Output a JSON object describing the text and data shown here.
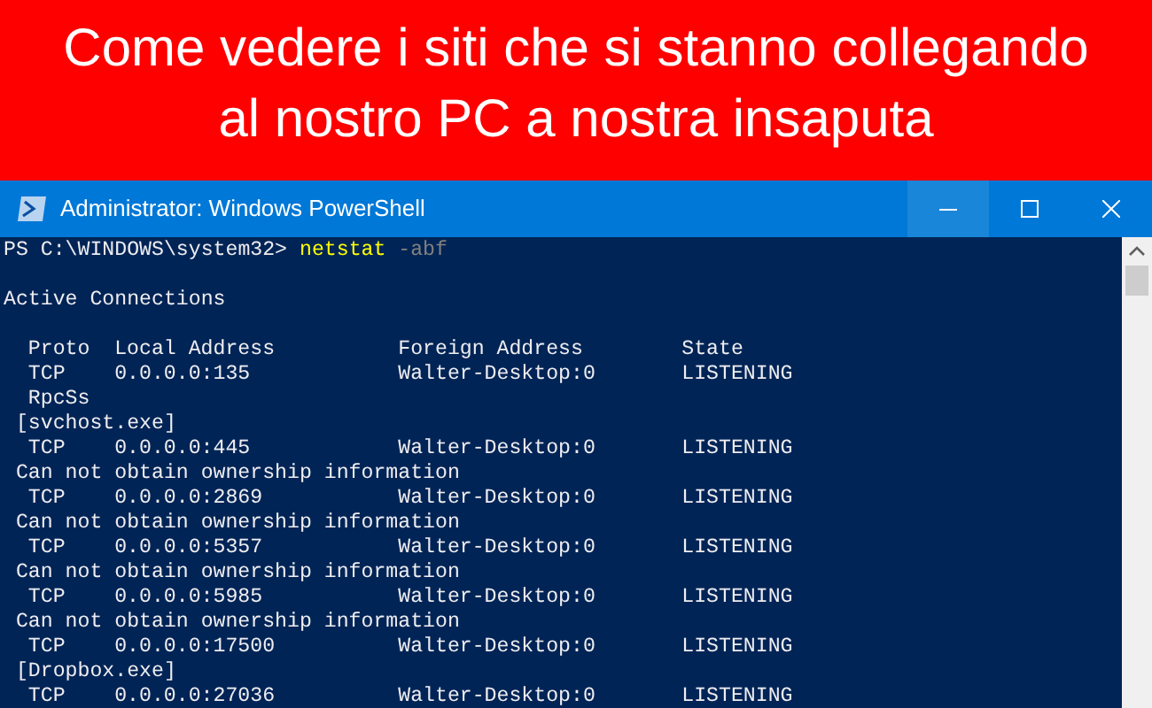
{
  "banner": {
    "title_lines": [
      "Come vedere i siti che si stanno collegando",
      "al nostro PC a nostra insaputa"
    ]
  },
  "window": {
    "title": "Administrator: Windows PowerShell",
    "buttons": [
      {
        "kind": "minimize",
        "hovered": true
      },
      {
        "kind": "maximize",
        "hovered": false
      },
      {
        "kind": "close",
        "hovered": false
      }
    ]
  },
  "console": {
    "lines": [
      {
        "kind": "prompt",
        "path": "PS C:\\WINDOWS\\system32>",
        "command": "netstat",
        "args": "-abf"
      },
      {
        "kind": "blank"
      },
      {
        "kind": "text",
        "text": "Active Connections"
      },
      {
        "kind": "blank"
      },
      {
        "kind": "header",
        "cells": [
          "Proto",
          "Local Address",
          "Foreign Address",
          "State"
        ]
      },
      {
        "kind": "row",
        "cells": [
          "TCP",
          "0.0.0.0:135",
          "Walter-Desktop:0",
          "LISTENING"
        ]
      },
      {
        "kind": "service",
        "text": "RpcSs"
      },
      {
        "kind": "owner",
        "text": "[svchost.exe]"
      },
      {
        "kind": "row",
        "cells": [
          "TCP",
          "0.0.0.0:445",
          "Walter-Desktop:0",
          "LISTENING"
        ]
      },
      {
        "kind": "owner",
        "text": "Can not obtain ownership information"
      },
      {
        "kind": "row",
        "cells": [
          "TCP",
          "0.0.0.0:2869",
          "Walter-Desktop:0",
          "LISTENING"
        ]
      },
      {
        "kind": "owner",
        "text": "Can not obtain ownership information"
      },
      {
        "kind": "row",
        "cells": [
          "TCP",
          "0.0.0.0:5357",
          "Walter-Desktop:0",
          "LISTENING"
        ]
      },
      {
        "kind": "owner",
        "text": "Can not obtain ownership information"
      },
      {
        "kind": "row",
        "cells": [
          "TCP",
          "0.0.0.0:5985",
          "Walter-Desktop:0",
          "LISTENING"
        ]
      },
      {
        "kind": "owner",
        "text": "Can not obtain ownership information"
      },
      {
        "kind": "row",
        "cells": [
          "TCP",
          "0.0.0.0:17500",
          "Walter-Desktop:0",
          "LISTENING"
        ]
      },
      {
        "kind": "owner",
        "text": "[Dropbox.exe]"
      },
      {
        "kind": "row",
        "cells": [
          "TCP",
          "0.0.0.0:27036",
          "Walter-Desktop:0",
          "LISTENING"
        ]
      }
    ]
  }
}
